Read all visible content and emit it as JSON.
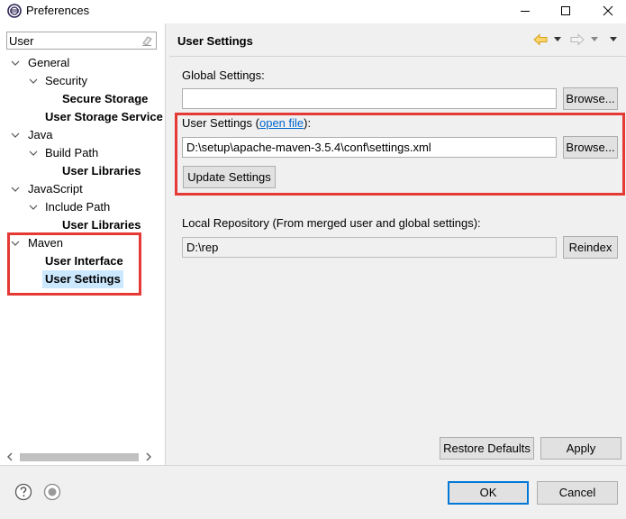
{
  "window": {
    "title": "Preferences",
    "minimize_glyph": "—",
    "maximize_glyph": "☐",
    "close_glyph": "✕"
  },
  "filter": {
    "value": "User",
    "placeholder": "type filter text",
    "clear_icon": "eraser-icon"
  },
  "tree": {
    "general": "General",
    "security": "Security",
    "secure_storage": "Secure Storage",
    "user_storage_service": "User Storage Service",
    "java": "Java",
    "build_path": "Build Path",
    "java_user_libraries": "User Libraries",
    "javascript": "JavaScript",
    "include_path": "Include Path",
    "js_user_libraries": "User Libraries",
    "maven": "Maven",
    "user_interface": "User Interface",
    "user_settings": "User Settings"
  },
  "page": {
    "title": "User Settings",
    "global_settings_label": "Global Settings:",
    "global_settings_value": "",
    "browse_label": "Browse...",
    "user_settings_label_prefix": "User Settings (",
    "open_file_link": "open file",
    "user_settings_label_suffix": "):",
    "user_settings_value": "D:\\setup\\apache-maven-3.5.4\\conf\\settings.xml",
    "update_settings_label": "Update Settings",
    "local_repo_label": "Local Repository (From merged user and global settings):",
    "local_repo_value": "D:\\rep",
    "reindex_label": "Reindex",
    "restore_defaults_label": "Restore Defaults",
    "apply_label": "Apply"
  },
  "footer": {
    "ok_label": "OK",
    "cancel_label": "Cancel"
  },
  "colors": {
    "highlight_box": "#e53935",
    "selection": "#cce8ff",
    "link": "#0066cc",
    "nav_arrow": "#e8a317"
  }
}
